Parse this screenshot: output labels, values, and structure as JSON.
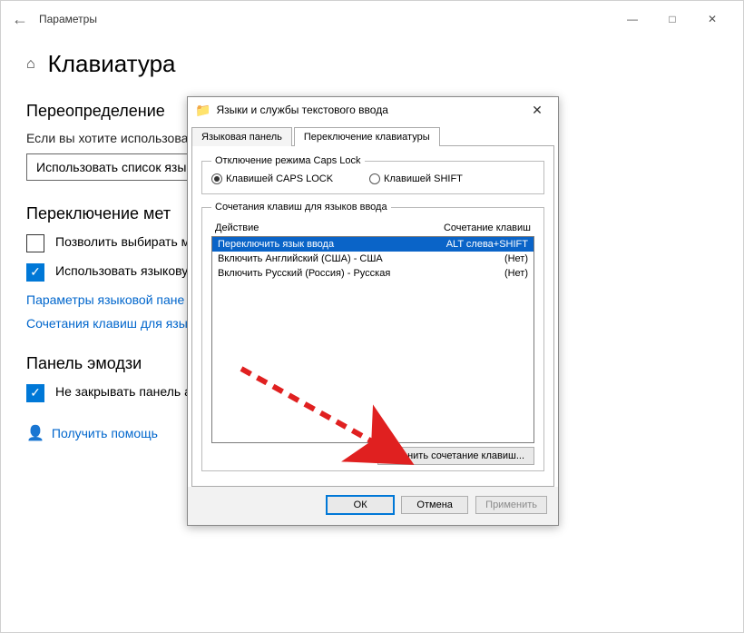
{
  "settings": {
    "window_title": "Параметры",
    "page_title": "Клавиатура",
    "section_override": "Переопределение",
    "override_desc": "Если вы хотите использовать первом месте в вашем спи",
    "dropdown_label": "Использовать список язы",
    "section_switching": "Переключение мет",
    "check_allow": "Позволить выбирать м приложения",
    "check_use_langbar": "Использовать языкову доступна",
    "link_langbar_params": "Параметры языковой пане",
    "link_hotkeys": "Сочетания клавиш для язы",
    "section_emoji": "Панель эмодзи",
    "check_emoji": "Не закрывать панель автоматически после ввода эмодзи",
    "help_link": "Получить помощь"
  },
  "modal": {
    "title": "Языки и службы текстового ввода",
    "tabs": [
      "Языковая панель",
      "Переключение клавиатуры"
    ],
    "capslock_group": "Отключение режима Caps Lock",
    "radio_caps": "Клавишей CAPS LOCK",
    "radio_shift": "Клавишей SHIFT",
    "hotkeys_group": "Сочетания клавиш для языков ввода",
    "col_action": "Действие",
    "col_combo": "Сочетание клавиш",
    "rows": [
      {
        "action": "Переключить язык ввода",
        "combo": "ALT слева+SHIFT"
      },
      {
        "action": "Включить Английский (США) - США",
        "combo": "(Нет)"
      },
      {
        "action": "Включить Русский (Россия) - Русская",
        "combo": "(Нет)"
      }
    ],
    "btn_change": "Сменить сочетание клавиш...",
    "btn_ok": "ОК",
    "btn_cancel": "Отмена",
    "btn_apply": "Применить"
  }
}
